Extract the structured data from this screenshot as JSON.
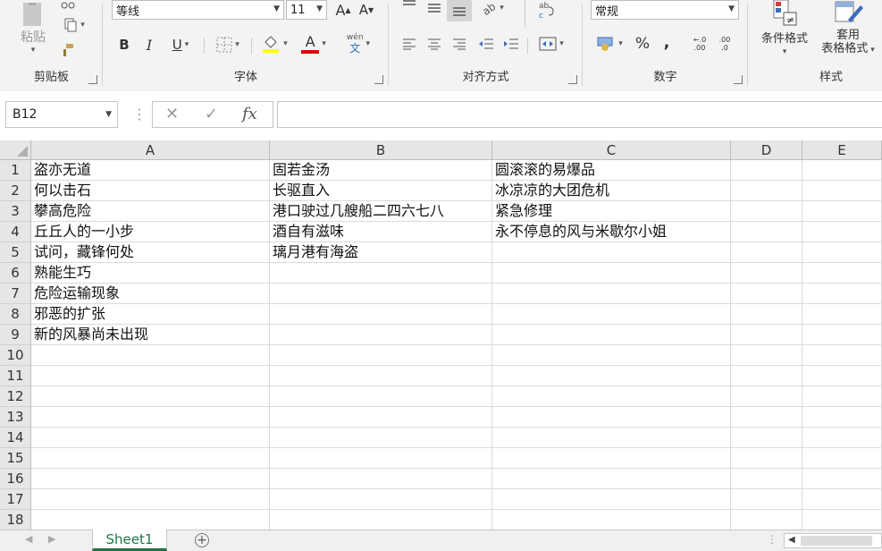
{
  "ribbon": {
    "clipboard": {
      "group_label": "剪贴板",
      "paste_label": "粘贴"
    },
    "font": {
      "group_label": "字体",
      "font_name": "等线",
      "font_size": "11",
      "grow_label": "A",
      "shrink_label": "A",
      "bold": "B",
      "italic": "I",
      "underline": "U",
      "font_color_letter": "A",
      "phonetic_label": "文"
    },
    "alignment": {
      "group_label": "对齐方式"
    },
    "number": {
      "group_label": "数字",
      "format": "常规",
      "percent": "%",
      "comma": ",",
      "inc_decimal": ".00",
      "dec_decimal": ".0"
    },
    "styles": {
      "group_label": "样式",
      "conditional_label": "条件格式",
      "table_label_1": "套用",
      "table_label_2": "表格格式"
    }
  },
  "formula_bar": {
    "name_box": "B12",
    "fx": "fx",
    "cancel": "✕",
    "enter": "✓",
    "value": ""
  },
  "columns": [
    "A",
    "B",
    "C",
    "D",
    "E"
  ],
  "rows": [
    "1",
    "2",
    "3",
    "4",
    "5",
    "6",
    "7",
    "8",
    "9",
    "10",
    "11",
    "12",
    "13",
    "14",
    "15",
    "16",
    "17",
    "18"
  ],
  "cells": {
    "A": [
      "盗亦无道",
      "何以击石",
      "攀高危险",
      "丘丘人的一小步",
      "试问，藏锋何处",
      "熟能生巧",
      "危险运输现象",
      "邪恶的扩张",
      "新的风暴尚未出现"
    ],
    "B": [
      "固若金汤",
      "长驱直入",
      "港口驶过几艘船二四六七八",
      "酒自有滋味",
      "璃月港有海盗"
    ],
    "C": [
      "圆滚滚的易爆品",
      "冰凉凉的大团危机",
      "紧急修理",
      "永不停息的风与米歇尔小姐"
    ]
  },
  "sheets": {
    "active": "Sheet1"
  },
  "colors": {
    "accent": "#217346",
    "highlight": "#ffff00",
    "font_red": "#e00000"
  }
}
